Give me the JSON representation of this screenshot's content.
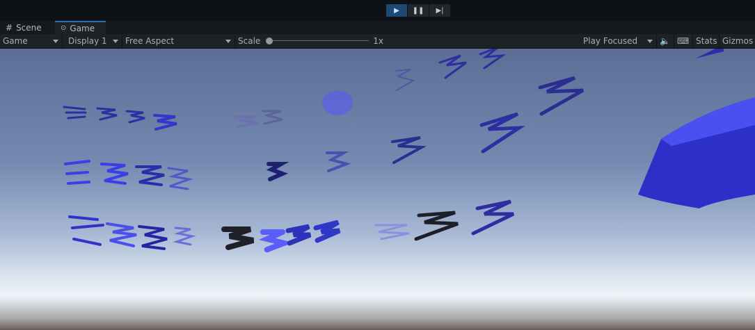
{
  "play_controls": {
    "play": "▶",
    "pause": "❚❚",
    "step": "▶|"
  },
  "tabs": [
    {
      "label": "Scene",
      "icon": "grid-icon"
    },
    {
      "label": "Game",
      "icon": "gamepad-icon"
    }
  ],
  "toolbar": {
    "view_mode": "Game",
    "display": "Display 1",
    "aspect": "Free Aspect",
    "scale_label": "Scale",
    "scale_value": "1x",
    "scale_fraction": 0,
    "play_mode": "Play Focused",
    "stats": "Stats",
    "gizmos": "Gizmos"
  },
  "colors": {
    "accent": "#1d4a75",
    "stroke": "#3a3ae0"
  }
}
